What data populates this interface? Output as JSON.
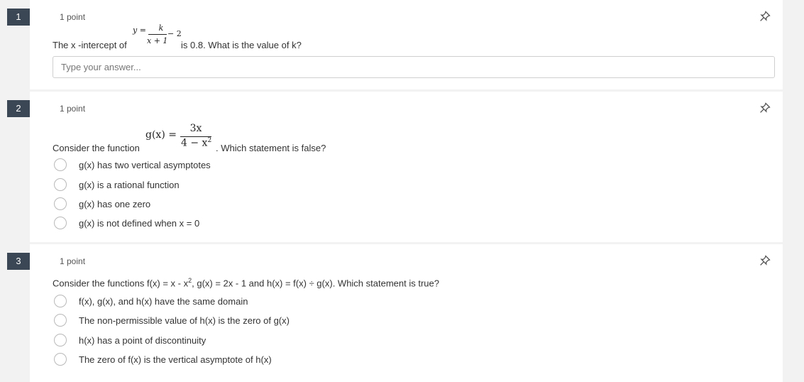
{
  "questions": [
    {
      "number": "1",
      "points": "1 point",
      "stem_prefix": "The x -intercept of",
      "formula": {
        "lhs": "y =",
        "numerator": "k",
        "denominator": "x + 1",
        "tail": "− 2"
      },
      "stem_suffix": "is 0.8. What is the value of k?",
      "input_placeholder": "Type your answer..."
    },
    {
      "number": "2",
      "points": "1 point",
      "stem_prefix": "Consider the function",
      "formula": {
        "lhs": "g(x) =",
        "numerator": "3x",
        "denominator": "4 − x",
        "exp": "2"
      },
      "stem_suffix": ". Which statement is false?",
      "options": [
        "g(x) has two vertical asymptotes",
        "g(x) is a rational function",
        "g(x) has one zero",
        "g(x) is not defined when x = 0"
      ]
    },
    {
      "number": "3",
      "points": "1 point",
      "stem_a": "Consider the functions f(x) = x - x",
      "stem_exp": "2",
      "stem_b": ", g(x) = 2x - 1 and h(x) = f(x) ÷ g(x). Which statement is true?",
      "options": [
        "f(x), g(x), and h(x) have the same domain",
        "The non-permissible value of h(x) is the zero of g(x)",
        "h(x) has a point of discontinuity",
        "The zero of f(x) is the vertical asymptote of h(x)"
      ]
    }
  ],
  "icons": {
    "pin": "pin-icon"
  },
  "colors": {
    "badge": "#3b4754",
    "page_bg": "#f2f2f2",
    "card_bg": "#ffffff"
  }
}
